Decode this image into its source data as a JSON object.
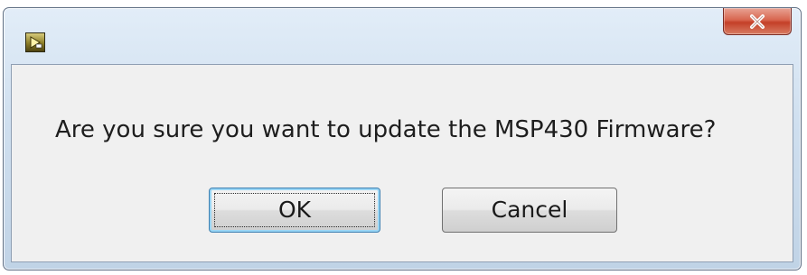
{
  "dialog": {
    "message": "Are you sure you want to update the MSP430 Firmware?",
    "buttons": {
      "ok": "OK",
      "cancel": "Cancel"
    },
    "app_icon": "labview-run-icon",
    "close_icon": "close-icon"
  },
  "colors": {
    "title_bar": "#cfdfef",
    "close_button": "#c43f28",
    "client_area": "#f0f0f0",
    "default_button_border": "#3c7fb1"
  }
}
